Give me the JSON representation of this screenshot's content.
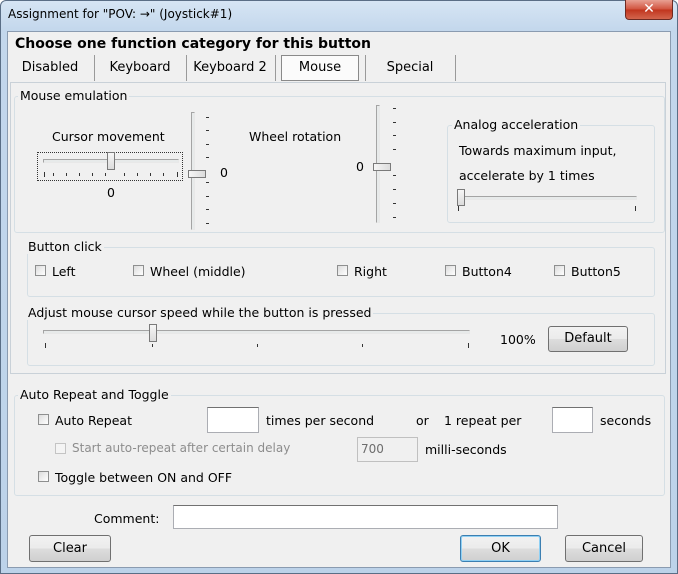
{
  "window": {
    "title": "Assignment for \"POV: →\" (Joystick#1)",
    "close_icon": "close-icon"
  },
  "header": {
    "instruction": "Choose one function category for this button"
  },
  "tabs": [
    {
      "label": "Disabled"
    },
    {
      "label": "Keyboard"
    },
    {
      "label": "Keyboard 2"
    },
    {
      "label": "Mouse"
    },
    {
      "label": "Special"
    }
  ],
  "selected_tab": "Mouse",
  "mouse_emulation": {
    "group_label": "Mouse emulation",
    "cursor_label": "Cursor movement",
    "cursor_x_value": "0",
    "cursor_y_value": "0",
    "wheel_label": "Wheel rotation",
    "wheel_value": "0",
    "analog": {
      "group_label": "Analog acceleration",
      "line1": "Towards maximum input,",
      "line2": "accelerate by 1 times",
      "slider_level": 0
    }
  },
  "button_click": {
    "group_label": "Button click",
    "options": [
      {
        "label": "Left"
      },
      {
        "label": "Wheel (middle)"
      },
      {
        "label": "Right"
      },
      {
        "label": "Button4"
      },
      {
        "label": "Button5"
      }
    ]
  },
  "speed": {
    "group_label": "Adjust mouse cursor speed while the button is pressed",
    "value": "100%",
    "default_button": "Default"
  },
  "auto_repeat": {
    "group_label": "Auto Repeat and Toggle",
    "auto_repeat_label": "Auto Repeat",
    "times_per_second": "times per second",
    "or": "or",
    "one_repeat_per": "1 repeat per",
    "seconds": "seconds",
    "delay_label": "Start auto-repeat after certain delay",
    "delay_value": "700",
    "ms_label": "milli-seconds",
    "toggle_label": "Toggle between ON and OFF"
  },
  "comment": {
    "label": "Comment:",
    "value": ""
  },
  "buttons": {
    "clear": "Clear",
    "ok": "OK",
    "cancel": "Cancel"
  }
}
